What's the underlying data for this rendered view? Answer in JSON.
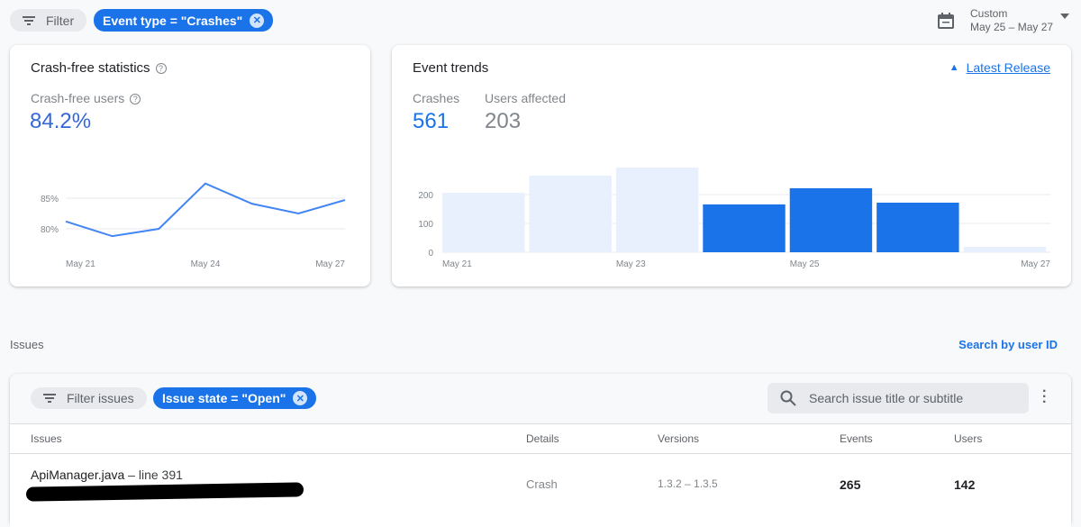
{
  "toolbar": {
    "filter_label": "Filter",
    "filter_chip": "Event type = \"Crashes\"",
    "date_range_label": "Custom",
    "date_range_value": "May 25 – May 27"
  },
  "crash_free": {
    "title": "Crash-free statistics",
    "metric_label": "Crash-free users",
    "metric_value": "84.2%"
  },
  "event_trends": {
    "title": "Event trends",
    "latest_release_link": "Latest Release",
    "crashes_label": "Crashes",
    "crashes_value": "561",
    "users_label": "Users affected",
    "users_value": "203"
  },
  "chart_data": [
    {
      "type": "line",
      "x": [
        "May 21",
        "May 22",
        "May 23",
        "May 24",
        "May 25",
        "May 26",
        "May 27"
      ],
      "y": [
        81.2,
        78.8,
        80.0,
        87.4,
        84.1,
        82.5,
        84.7
      ],
      "y_ticks": [
        "80%",
        "85%"
      ],
      "x_ticks": [
        "May 21",
        "May 24",
        "May 27"
      ],
      "color": "#4285f4",
      "grid": true
    },
    {
      "type": "bar",
      "categories": [
        "May 21",
        "May 22",
        "May 23",
        "May 24",
        "May 25",
        "May 26",
        "May 27"
      ],
      "values": [
        206,
        266,
        294,
        166,
        222,
        172,
        19
      ],
      "selected": [
        false,
        false,
        false,
        true,
        true,
        true,
        false
      ],
      "y_ticks": [
        "0",
        "100",
        "200"
      ],
      "x_ticks": [
        "May 21",
        "May 23",
        "May 25",
        "May 27"
      ],
      "colors": {
        "selected": "#1a73e8",
        "unselected": "#e8f0fe"
      },
      "grid": true
    }
  ],
  "issues": {
    "section_label": "Issues",
    "search_by_user": "Search by user ID",
    "filter_label": "Filter issues",
    "state_chip": "Issue state = \"Open\"",
    "search_placeholder": "Search issue title or subtitle",
    "columns": [
      "Issues",
      "Details",
      "Versions",
      "Events",
      "Users"
    ],
    "rows": [
      {
        "file": "ApiManager.java",
        "line": " – line 391",
        "details": "Crash",
        "versions": "1.3.2 – 1.3.5",
        "events": "265",
        "users": "142"
      }
    ]
  }
}
